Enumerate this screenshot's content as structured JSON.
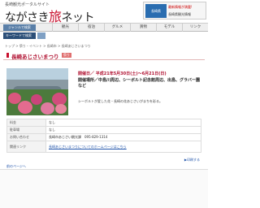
{
  "header": {
    "site_sub": "長崎観光ポータルサイト",
    "logo_pre": "ながさき",
    "logo_accent": "旅",
    "logo_post": "ネット",
    "banner_tag": "長崎県",
    "banner_line1": "最新情報が満載!",
    "banner_line2": "長崎県観光情報"
  },
  "nav": {
    "genre_label": "ジャンルで検索",
    "items": [
      "観光",
      "宿泊",
      "グルメ",
      "買物",
      "モデル",
      "リンク"
    ]
  },
  "search": {
    "label": "キーワードで検索"
  },
  "breadcrumb": "トップ > 祭り・イベント > 長崎市 > 長崎あじさいまつり",
  "page": {
    "title": "長崎あじさいまつり",
    "badge": "祭り",
    "date": "開催日／ 平成21年5月30日(土)～6月21日(日)",
    "place": "開催場所／中島川周辺、シーボルト記念館周辺、出島、グラバー園など",
    "description": "シーボルトが愛した花・長崎の花あじさいがまちを彩る。"
  },
  "table": {
    "rows": [
      {
        "label": "料金",
        "value": "なし",
        "link": false
      },
      {
        "label": "駐車場",
        "value": "なし",
        "link": false
      },
      {
        "label": "お問い合わせ",
        "value": "長崎市あじさい観光課　095-829-1314",
        "link": false
      },
      {
        "label": "関連リンク",
        "value": "長崎あじさいまつりについてのホームページはこちら",
        "link": true
      }
    ]
  },
  "print_label": "▶印刷する",
  "prev_label": "前のページへ"
}
